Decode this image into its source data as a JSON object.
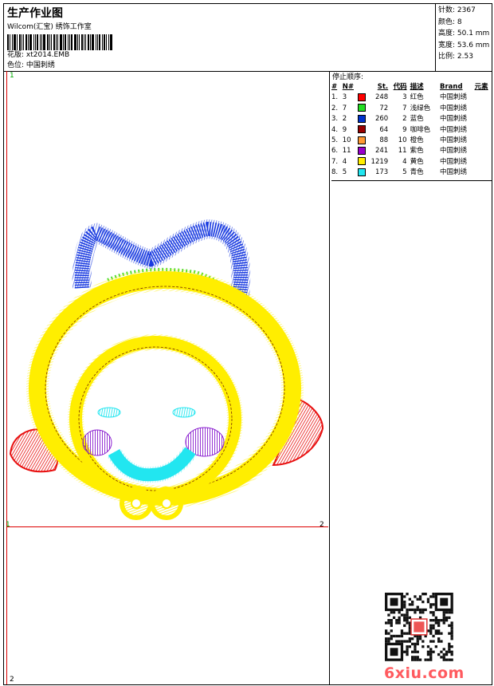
{
  "header": {
    "title": "生产作业图",
    "org": "Wilcom(汇宝) 绣饰工作室",
    "design_label": "花版:",
    "design_value": "xt2014.EMB",
    "colorway_label": "色位:",
    "colorway_value": "中国刺绣"
  },
  "stats": {
    "stitches": "针数: 2367",
    "colors": "颜色: 8",
    "height": "高度: 50.1 mm",
    "width": "宽度: 53.6 mm",
    "ratio": "比例: 2.53"
  },
  "canvas": {
    "marker_top": "1",
    "marker_left": "1",
    "marker_right": "2",
    "marker_bottom": "2"
  },
  "stop_sequence": {
    "title": "停止顺序:",
    "headers": [
      "#",
      "N#",
      "St.",
      "代码",
      "描述",
      "Brand",
      "元素"
    ],
    "rows": [
      {
        "idx": "1.",
        "n": "3",
        "color": "#ff0000",
        "st": "248",
        "code": "3",
        "desc": "红色",
        "brand": "中国刺绣"
      },
      {
        "idx": "2.",
        "n": "7",
        "color": "#22dd22",
        "st": "72",
        "code": "7",
        "desc": "浅绿色",
        "brand": "中国刺绣"
      },
      {
        "idx": "3.",
        "n": "2",
        "color": "#0033cc",
        "st": "260",
        "code": "2",
        "desc": "蓝色",
        "brand": "中国刺绣"
      },
      {
        "idx": "4.",
        "n": "9",
        "color": "#990000",
        "st": "64",
        "code": "9",
        "desc": "咖啡色",
        "brand": "中国刺绣"
      },
      {
        "idx": "5.",
        "n": "10",
        "color": "#ff9933",
        "st": "88",
        "code": "10",
        "desc": "橙色",
        "brand": "中国刺绣"
      },
      {
        "idx": "6.",
        "n": "11",
        "color": "#9900cc",
        "st": "241",
        "code": "11",
        "desc": "紫色",
        "brand": "中国刺绣"
      },
      {
        "idx": "7.",
        "n": "4",
        "color": "#ffee00",
        "st": "1219",
        "code": "4",
        "desc": "黄色",
        "brand": "中国刺绣"
      },
      {
        "idx": "8.",
        "n": "5",
        "color": "#22e6f0",
        "st": "173",
        "code": "5",
        "desc": "青色",
        "brand": "中国刺绣"
      }
    ]
  },
  "watermark": "6xiu.com",
  "design_colors": {
    "yellow": "#ffee00",
    "blue": "#1a3be0",
    "red": "#e81010",
    "purple": "#8a1fd0",
    "cyan": "#22e6f0",
    "green": "#55dd33"
  }
}
